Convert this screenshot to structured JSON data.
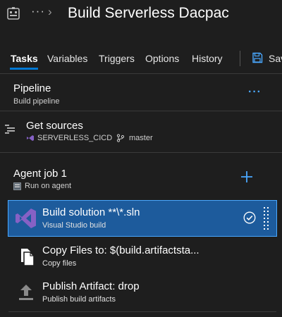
{
  "header": {
    "more_label": "···",
    "chevron": "›",
    "title": "Build Serverless Dacpac",
    "icon": "pipeline-icon"
  },
  "tabs": [
    {
      "label": "Tasks",
      "active": true
    },
    {
      "label": "Variables"
    },
    {
      "label": "Triggers"
    },
    {
      "label": "Options"
    },
    {
      "label": "History"
    }
  ],
  "toolbar": {
    "save_label": "Save",
    "save_icon": "save-icon"
  },
  "pipeline": {
    "title": "Pipeline",
    "subtitle": "Build pipeline",
    "more_label": "···"
  },
  "sources": {
    "title": "Get sources",
    "repo": "SERVERLESS_CICD",
    "branch": "master"
  },
  "agent_job": {
    "title": "Agent job 1",
    "subtitle": "Run on agent"
  },
  "tasks": [
    {
      "title": "Build solution **\\*.sln",
      "subtitle": "Visual Studio build",
      "selected": true,
      "icon": "visual-studio-icon"
    },
    {
      "title": "Copy Files to: $(build.artifactsta...",
      "subtitle": "Copy files",
      "icon": "copy-files-icon"
    },
    {
      "title": "Publish Artifact: drop",
      "subtitle": "Publish build artifacts",
      "icon": "upload-icon"
    }
  ],
  "colors": {
    "background": "#1e1e1e",
    "accent": "#0078d4",
    "selected_row": "#1d5b9c",
    "link": "#4aa8ff",
    "vs_purple": "#8661c5"
  }
}
